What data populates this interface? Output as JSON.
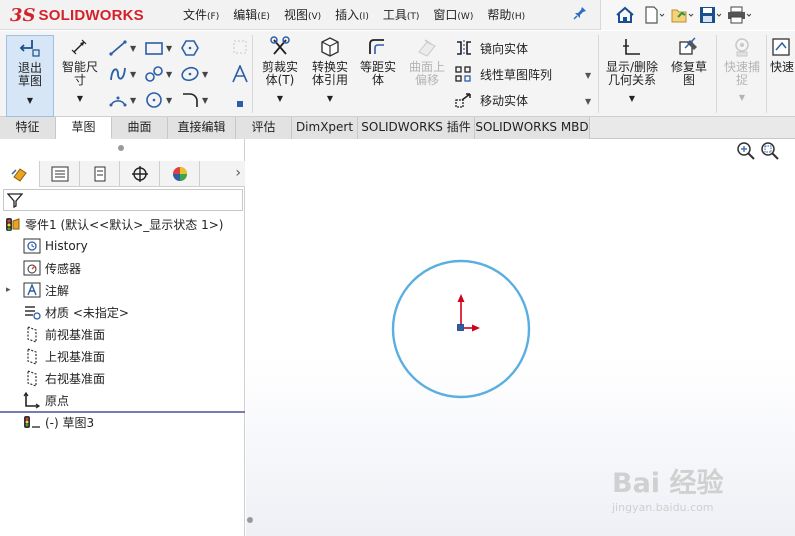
{
  "app": {
    "logo_mark": "3S",
    "logo_text": "SOLIDWORKS"
  },
  "menus": [
    {
      "label": "文件",
      "key": "(F)"
    },
    {
      "label": "编辑",
      "key": "(E)"
    },
    {
      "label": "视图",
      "key": "(V)"
    },
    {
      "label": "插入",
      "key": "(I)"
    },
    {
      "label": "工具",
      "key": "(T)"
    },
    {
      "label": "窗口",
      "key": "(W)"
    },
    {
      "label": "帮助",
      "key": "(H)"
    }
  ],
  "ribbon": {
    "exit_sketch": "退出草图",
    "smart_dimension": "智能尺寸",
    "trim": "剪裁实体(T)",
    "convert": "转换实体引用",
    "offset": "等距实体",
    "surface_offset": "曲面上偏移",
    "mirror": "镜向实体",
    "linear_pattern": "线性草图阵列",
    "move": "移动实体",
    "show_relations": "显示/删除几何关系",
    "repair": "修复草图",
    "quick_snap": "快速捕捉",
    "rapid": "快速"
  },
  "tabs": [
    "特征",
    "草图",
    "曲面",
    "直接编辑",
    "评估",
    "DimXpert",
    "SOLIDWORKS 插件",
    "SOLIDWORKS MBD"
  ],
  "active_tab": "草图",
  "tree": {
    "part": "零件1 (默认<<默认>_显示状态 1>)",
    "history": "History",
    "sensors": "传感器",
    "annotations": "注解",
    "material": "材质 <未指定>",
    "front_plane": "前视基准面",
    "top_plane": "上视基准面",
    "right_plane": "右视基准面",
    "origin": "原点",
    "sketch": "(-) 草图3"
  },
  "watermark": {
    "main": "Bai 经验",
    "sub": "jingyan.baidu.com"
  },
  "colors": {
    "brand": "#d4222a",
    "circle": "#5aaee0",
    "axis_y": "#d0021b",
    "rollback": "#7b7bb3"
  }
}
